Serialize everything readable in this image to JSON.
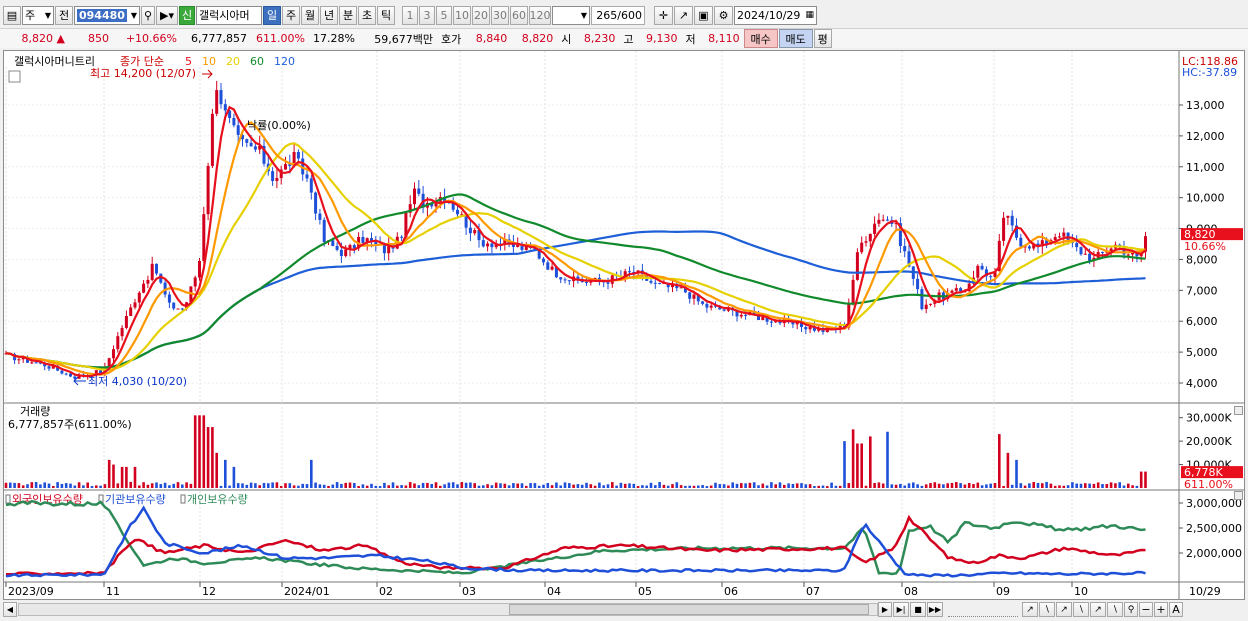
{
  "toolbar": {
    "market": "주",
    "prev": "전",
    "code": "094480",
    "stock_name": "갤럭시아머",
    "new_badge": "신",
    "periods": [
      {
        "label": "일",
        "selected": true
      },
      {
        "label": "주",
        "selected": false
      },
      {
        "label": "월",
        "selected": false
      },
      {
        "label": "년",
        "selected": false
      },
      {
        "label": "분",
        "selected": false
      },
      {
        "label": "초",
        "selected": false
      },
      {
        "label": "틱",
        "selected": false
      }
    ],
    "intervals": [
      "1",
      "3",
      "5",
      "10",
      "20",
      "30",
      "60",
      "120"
    ],
    "count": "265",
    "count_total": "/600",
    "date": "2024/10/29"
  },
  "quote": {
    "price": "8,820",
    "up_arrow": "▲",
    "change": "850",
    "change_pct": "+10.66%",
    "volume": "6,777,857",
    "volume_ratio": "611.00%",
    "turnover": "17.28%",
    "amount": "59,677백만",
    "ask_label": "호가",
    "ask": "8,840",
    "bid": "8,820",
    "open_label": "시",
    "open": "8,230",
    "high_label": "고",
    "high": "9,130",
    "low_label": "저",
    "low": "8,110",
    "buy_btn": "매수",
    "sell_btn": "매도",
    "eval_btn": "평"
  },
  "chart": {
    "price_legend": {
      "name": "갤럭시아머니트리",
      "ma_label": "종가 단순",
      "periods": [
        {
          "p": "5",
          "color": "#e8101c"
        },
        {
          "p": "10",
          "color": "#ff9900"
        },
        {
          "p": "20",
          "color": "#e6d000"
        },
        {
          "p": "60",
          "color": "#118a2c"
        },
        {
          "p": "120",
          "color": "#1e5fd8"
        }
      ]
    },
    "high_mark": "최고 14,200 (12/07)",
    "low_mark": "최저 4,030 (10/20)",
    "drop_label": "낙률(0.00%)",
    "lc": "LC:118.86",
    "hc": "HC:-37.89",
    "price_axis": [
      "13,000",
      "12,000",
      "11,000",
      "10,000",
      "9,000",
      "8,000",
      "7,000",
      "6,000",
      "5,000",
      "4,000"
    ],
    "price_values": [
      13000,
      12000,
      11000,
      10000,
      9000,
      8000,
      7000,
      6000,
      5000,
      4000
    ],
    "price_tag": "8,820",
    "price_tag_pct": "10.66%",
    "volume": {
      "title": "거래량",
      "value": "6,777,857주(611.00%)",
      "axis": [
        "30,000K",
        "20,000K",
        "10,000K"
      ],
      "tag": "6,778K",
      "tag_pct": "611.00%"
    },
    "holdings": {
      "series": [
        {
          "name": "외국인보유수량",
          "color": "#d2001e"
        },
        {
          "name": "기관보유수량",
          "color": "#1e4fd8"
        },
        {
          "name": "개인보유수량",
          "color": "#2e8b57"
        }
      ],
      "axis": [
        "3,000,000",
        "2,500,000",
        "2,000,000"
      ]
    },
    "x_labels": [
      {
        "t": "2023/09",
        "x": 2
      },
      {
        "t": "11",
        "x": 100
      },
      {
        "t": "12",
        "x": 196
      },
      {
        "t": "2024/01",
        "x": 278
      },
      {
        "t": "02",
        "x": 373
      },
      {
        "t": "03",
        "x": 456
      },
      {
        "t": "04",
        "x": 541
      },
      {
        "t": "05",
        "x": 632
      },
      {
        "t": "06",
        "x": 718
      },
      {
        "t": "07",
        "x": 800
      },
      {
        "t": "08",
        "x": 898
      },
      {
        "t": "09",
        "x": 990
      },
      {
        "t": "10",
        "x": 1068
      }
    ],
    "x_end_label": "10/29"
  }
}
